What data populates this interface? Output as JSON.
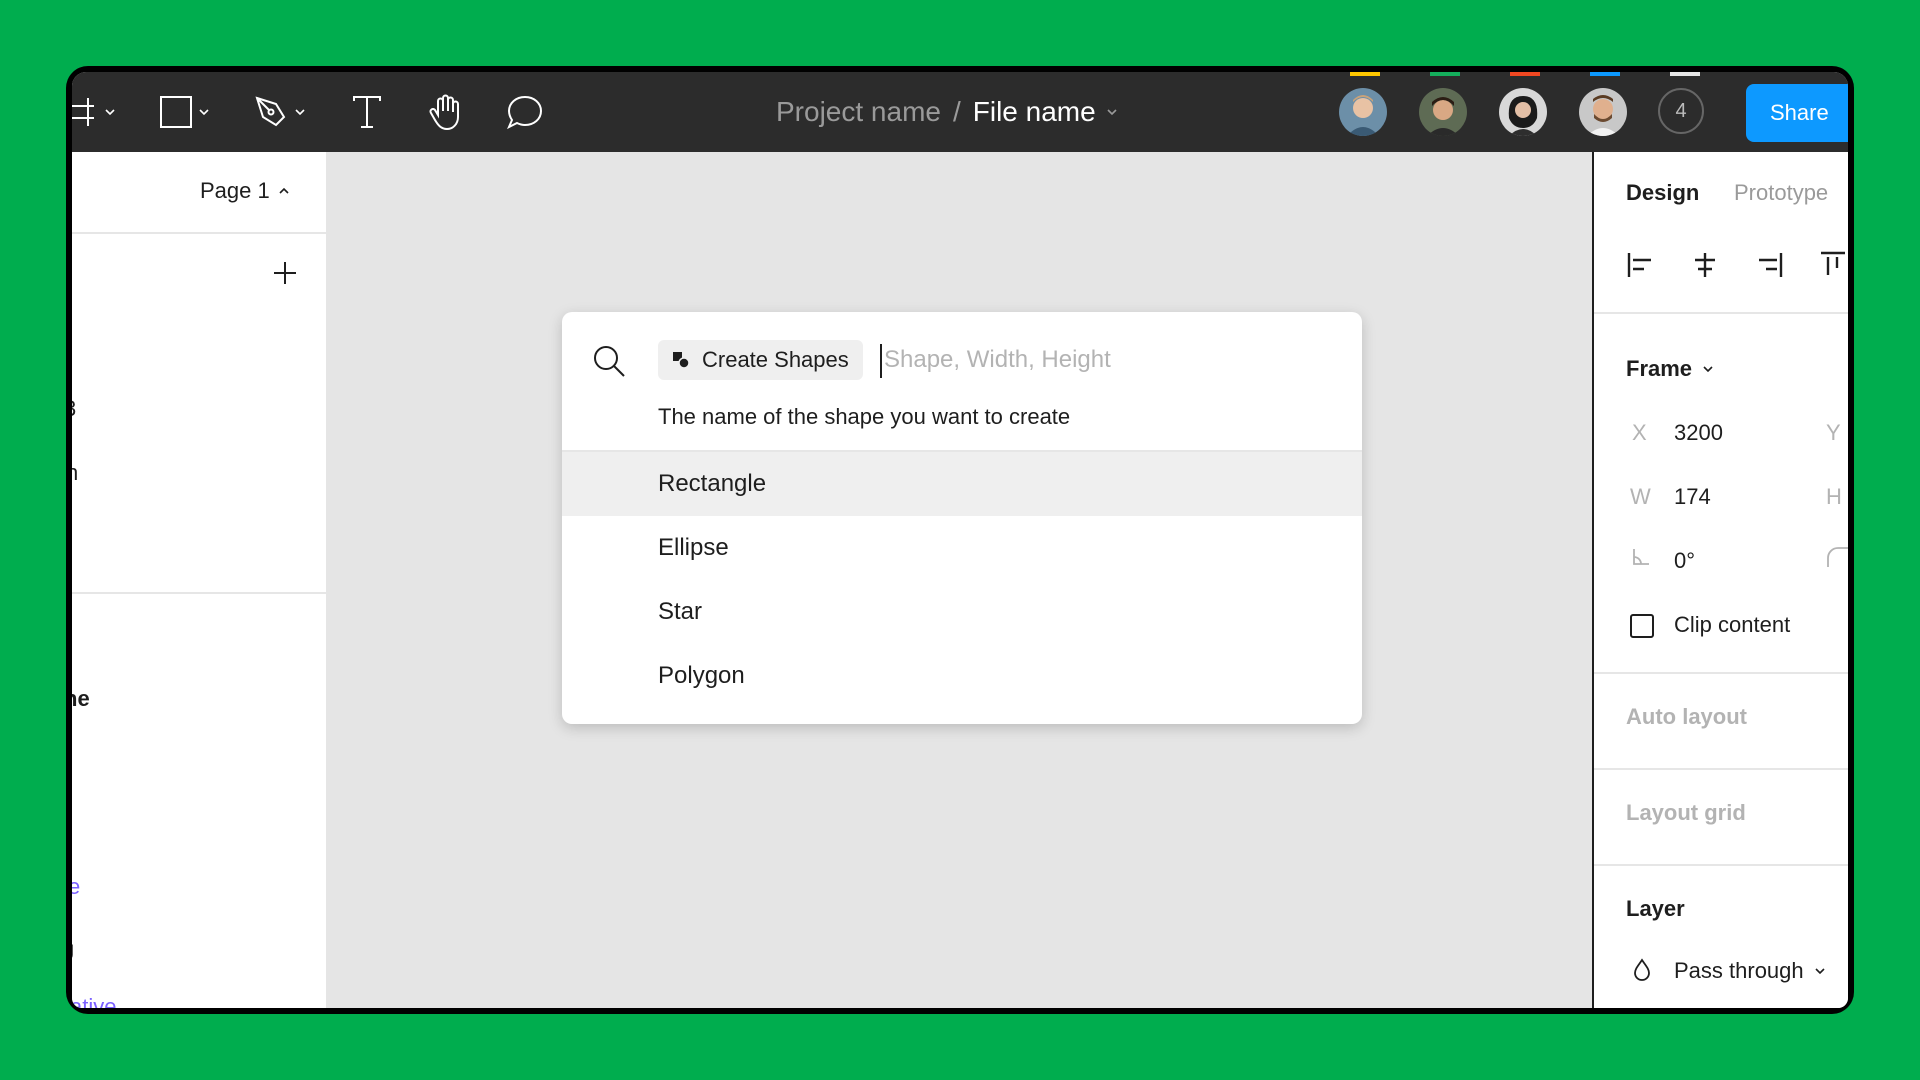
{
  "toolbar": {
    "tools": [
      "frame-tool",
      "rectangle-tool",
      "pen-tool",
      "text-tool",
      "hand-tool",
      "comment-tool"
    ],
    "breadcrumb": {
      "project": "Project name",
      "separator": "/",
      "file": "File name"
    },
    "collaborators": [
      {
        "name": "collaborator-1",
        "color": "#ffc700"
      },
      {
        "name": "collaborator-2",
        "color": "#14ae5c"
      },
      {
        "name": "collaborator-3",
        "color": "#f24822"
      },
      {
        "name": "collaborator-4",
        "color": "#0d99ff"
      }
    ],
    "extra_count": "4",
    "share_label": "Share"
  },
  "left_panel": {
    "page_label": "Page 1",
    "fragments": [
      "3",
      "n",
      "ne",
      "e",
      "J",
      "ative"
    ]
  },
  "palette": {
    "chip_label": "Create Shapes",
    "placeholder": "Shape, Width, Height",
    "hint": "The name of the shape you want to create",
    "options": [
      "Rectangle",
      "Ellipse",
      "Star",
      "Polygon"
    ]
  },
  "right_panel": {
    "tabs": [
      "Design",
      "Prototype"
    ],
    "frame_title": "Frame",
    "x_label": "X",
    "x_value": "3200",
    "y_label": "Y",
    "w_label": "W",
    "w_value": "174",
    "h_label": "H",
    "rotation_value": "0°",
    "clip_label": "Clip content",
    "auto_layout": "Auto layout",
    "layout_grid": "Layout grid",
    "layer_title": "Layer",
    "blend_mode": "Pass through"
  }
}
